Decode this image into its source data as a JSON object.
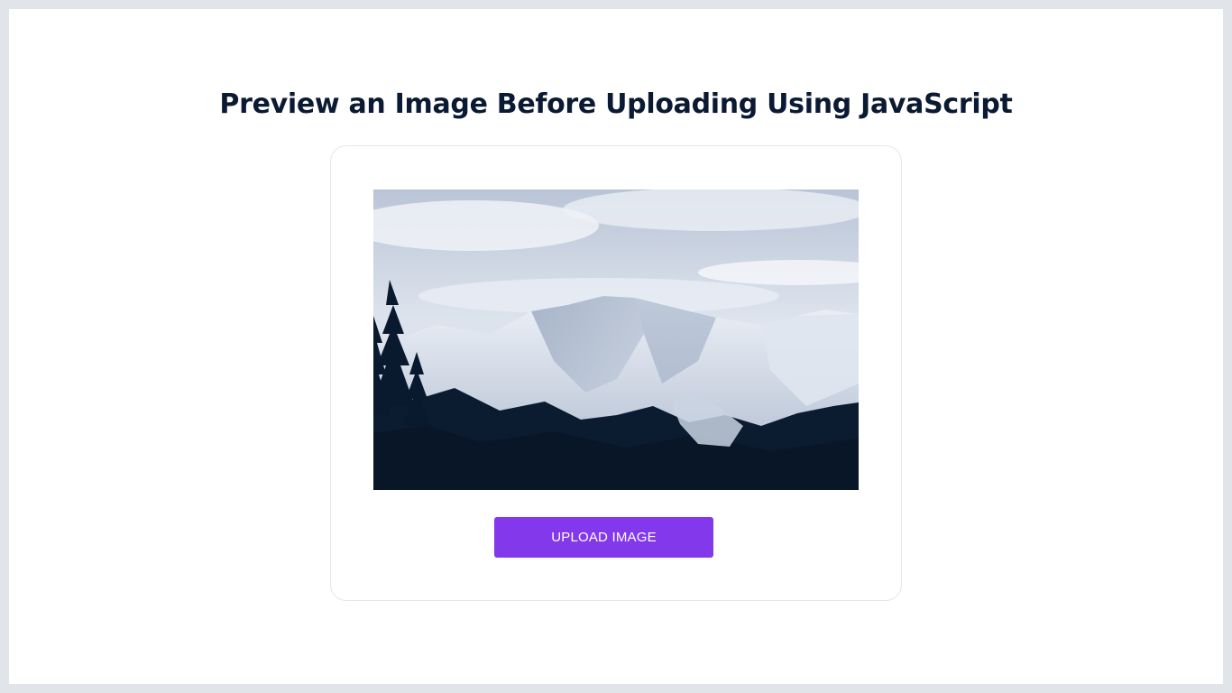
{
  "page": {
    "title": "Preview an Image Before Uploading Using JavaScript"
  },
  "uploader": {
    "preview_image_subject": "snowy mountain landscape with pine trees",
    "upload_button_label": "UPLOAD IMAGE",
    "accent_color": "#8338ec"
  }
}
